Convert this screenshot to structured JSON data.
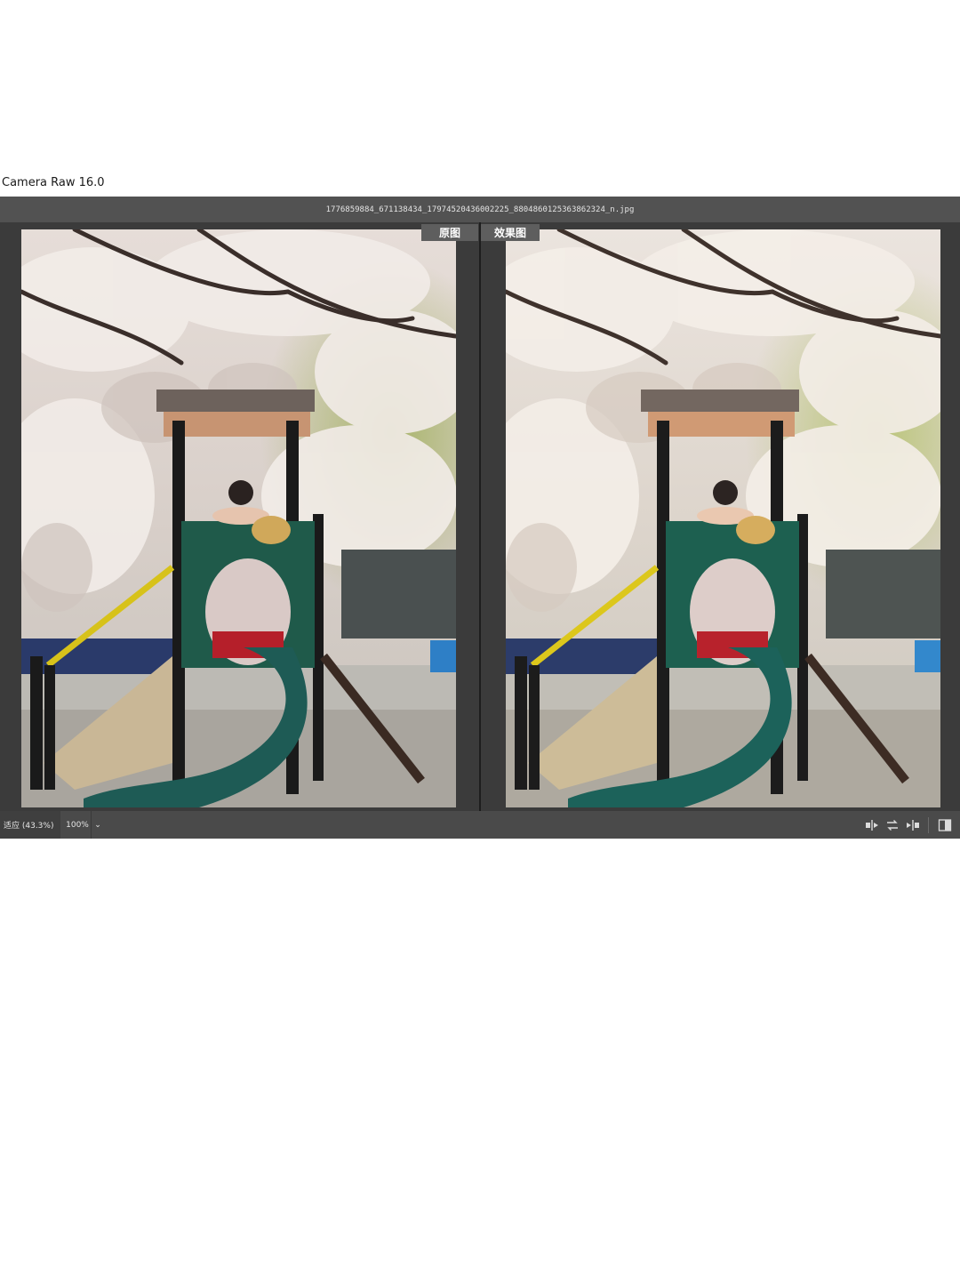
{
  "app": {
    "title": "Camera Raw 16.0"
  },
  "window": {
    "filename": "1776859884_671138434_17974520436002225_8804860125363862324_n.jpg"
  },
  "view": {
    "before_label": "原图",
    "after_label": "效果图"
  },
  "bottombar": {
    "zoom_fit": "适应 (43.3%)",
    "zoom_100": "100%",
    "zoom_dropdown": "⌄",
    "tools": [
      {
        "name": "swap-before-after-icon"
      },
      {
        "name": "copy-settings-icon"
      },
      {
        "name": "toggle-settings-icon"
      },
      {
        "name": "before-after-view-icon"
      }
    ]
  },
  "colors": {
    "window_bg": "#3b3b3b",
    "titlebar_bg": "#525252",
    "bottombar_bg": "#4a4a4a",
    "slide_green": "#1f5a4a",
    "sky_blossom": "#e9e2dd"
  }
}
